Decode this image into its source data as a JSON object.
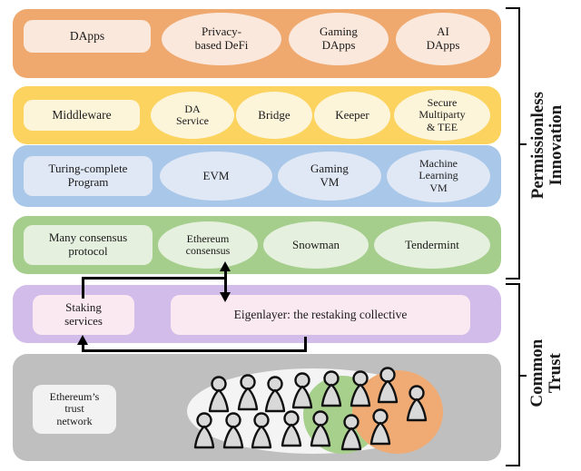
{
  "diagram": {
    "title": "Permissionless Innovation and Common Trust layered stack",
    "brackets": [
      {
        "id": "permissionless-innovation",
        "label": "Permissionless\nInnovation",
        "covers": "rows 1-4"
      },
      {
        "id": "common-trust",
        "label": "Common\nTrust",
        "covers": "rows 5-6"
      }
    ],
    "rows": [
      {
        "id": "dapps",
        "band_color": "#efa96f",
        "node_color": "#fbe8dc",
        "nodes": [
          {
            "shape": "rect",
            "label": "DApps"
          },
          {
            "shape": "ellipse",
            "label": "Privacy-\nbased DeFi"
          },
          {
            "shape": "ellipse",
            "label": "Gaming\nDApps"
          },
          {
            "shape": "ellipse",
            "label": "AI\nDApps"
          }
        ]
      },
      {
        "id": "middleware",
        "band_color": "#fbd35e",
        "node_color": "#fcf5da",
        "nodes": [
          {
            "shape": "rect",
            "label": "Middleware"
          },
          {
            "shape": "ellipse",
            "label": "DA\nService"
          },
          {
            "shape": "ellipse",
            "label": "Bridge"
          },
          {
            "shape": "ellipse",
            "label": "Keeper"
          },
          {
            "shape": "ellipse",
            "label": "Secure\nMultiparty\n& TEE"
          }
        ]
      },
      {
        "id": "turing-complete-program",
        "band_color": "#a9c7e8",
        "node_color": "#e0e8f5",
        "nodes": [
          {
            "shape": "rect",
            "label": "Turing-complete\nProgram"
          },
          {
            "shape": "ellipse",
            "label": "EVM"
          },
          {
            "shape": "ellipse",
            "label": "Gaming\nVM"
          },
          {
            "shape": "ellipse",
            "label": "Machine\nLearning\nVM"
          }
        ]
      },
      {
        "id": "consensus",
        "band_color": "#a5ce8c",
        "node_color": "#e6f0de",
        "nodes": [
          {
            "shape": "rect",
            "label": "Many consensus\nprotocol"
          },
          {
            "shape": "ellipse",
            "label": "Ethereum\nconsensus"
          },
          {
            "shape": "ellipse",
            "label": "Snowman"
          },
          {
            "shape": "ellipse",
            "label": "Tendermint"
          }
        ]
      },
      {
        "id": "restaking",
        "band_color": "#d2bce9",
        "node_color": "#fbe9f2",
        "nodes": [
          {
            "shape": "rect",
            "label": "Staking\nservices"
          },
          {
            "shape": "rect",
            "label": "Eigenlayer: the restaking collective"
          }
        ]
      },
      {
        "id": "trust-network",
        "band_color": "#bfbfbf",
        "node_color": "#f2f2f2",
        "nodes": [
          {
            "shape": "rect",
            "label": "Ethereum’s\ntrust\nnetwork"
          }
        ],
        "cluster": {
          "light_blob_color": "#f4f4f4",
          "green_blob_color": "#a8d08d",
          "orange_blob_color": "#f0ab74",
          "person_count": 15,
          "person_fill": "#d9d9d9"
        }
      }
    ],
    "connectors": [
      {
        "id": "consensus-eigenlayer-link",
        "kind": "double-arrow",
        "from": "Ethereum consensus",
        "to": "Eigenlayer: the restaking collective"
      },
      {
        "id": "staking-services-feed",
        "kind": "elbow-arrow",
        "from": "Eigenlayer link",
        "to": "Staking services"
      },
      {
        "id": "trust-network-to-staking",
        "kind": "elbow-arrow",
        "from": "Ethereum’s trust network",
        "to": "Staking services"
      }
    ]
  }
}
